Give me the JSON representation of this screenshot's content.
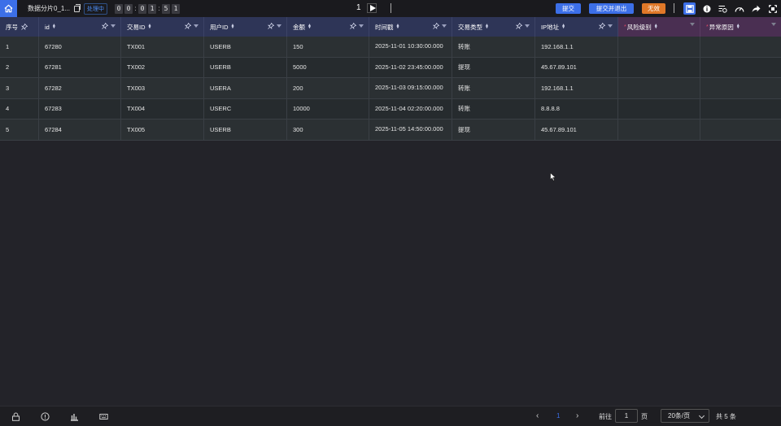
{
  "header": {
    "title": "数据分片0_1...",
    "status": "处理中",
    "timer_digits": [
      "0",
      "0",
      "0",
      "1",
      "5",
      "1"
    ],
    "current_page": "1",
    "submit_label": "提交",
    "submit_exit_label": "提交并退出",
    "invalid_label": "无效",
    "colors": {
      "accent": "#3c6fe8",
      "warning": "#e07828"
    },
    "tools": [
      "save-icon",
      "info-icon",
      "list-settings-icon",
      "speed-icon",
      "share-icon",
      "fullscreen-icon"
    ]
  },
  "table": {
    "columns": [
      {
        "label": "序号"
      },
      {
        "label": "id"
      },
      {
        "label": "交易ID"
      },
      {
        "label": "用户ID"
      },
      {
        "label": "金额"
      },
      {
        "label": "时间戳"
      },
      {
        "label": "交易类型"
      },
      {
        "label": "IP地址"
      },
      {
        "label": "风险级别",
        "required": "*"
      },
      {
        "label": "异常原因",
        "required": "*"
      }
    ],
    "rows": [
      [
        "1",
        "67280",
        "TX001",
        "USERB",
        "150",
        "2025-11-01 10:30:00.000",
        "转账",
        "192.168.1.1",
        "",
        ""
      ],
      [
        "2",
        "67281",
        "TX002",
        "USERB",
        "5000",
        "2025-11-02 23:45:00.000",
        "提现",
        "45.67.89.101",
        "",
        ""
      ],
      [
        "3",
        "67282",
        "TX003",
        "USERA",
        "200",
        "2025-11-03 09:15:00.000",
        "转账",
        "192.168.1.1",
        "",
        ""
      ],
      [
        "4",
        "67283",
        "TX004",
        "USERC",
        "10000",
        "2025-11-04 02:20:00.000",
        "转账",
        "8.8.8.8",
        "",
        ""
      ],
      [
        "5",
        "67284",
        "TX005",
        "USERB",
        "300",
        "2025-11-05 14:50:00.000",
        "提现",
        "45.67.89.101",
        "",
        ""
      ]
    ]
  },
  "footer": {
    "current_page": "1",
    "goto_label": "前往",
    "goto_value": "1",
    "page_unit": "页",
    "page_size": "20条/页",
    "total": "共 5 条",
    "icons": [
      "lock-icon",
      "info-circle-icon",
      "chart-icon",
      "keyboard-icon"
    ]
  }
}
